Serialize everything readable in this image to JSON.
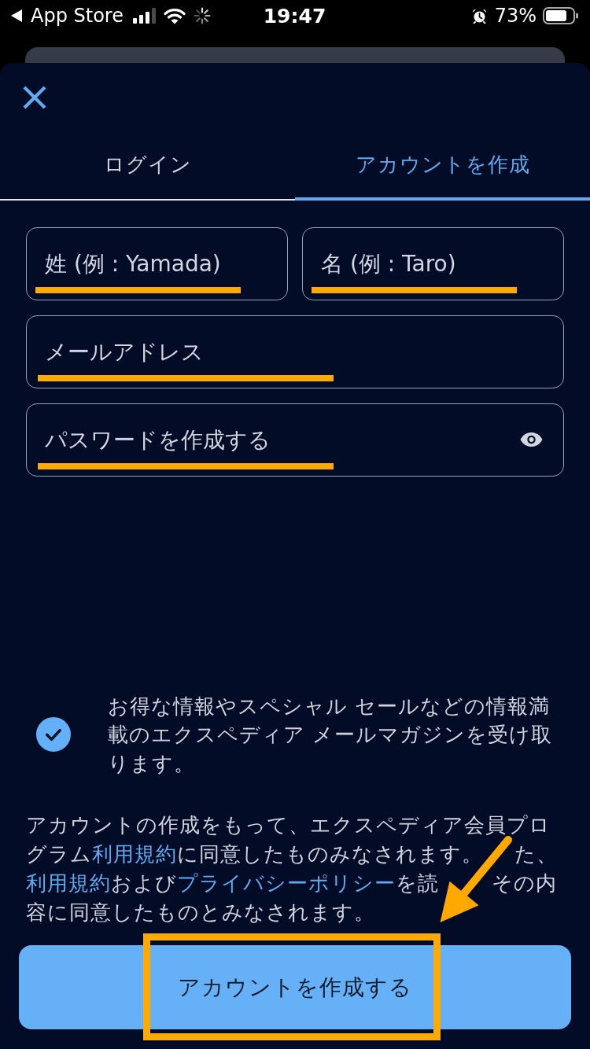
{
  "status_bar": {
    "back_label": "App Store",
    "time": "19:47",
    "battery": "73%"
  },
  "tabs": [
    {
      "label": "ログイン",
      "selected": false
    },
    {
      "label": "アカウントを作成",
      "selected": true
    }
  ],
  "field_rows": [
    [
      {
        "kind": "text",
        "placeholder": "姓 (例 : Yamada)",
        "highlighted": true
      },
      {
        "kind": "text",
        "placeholder": "名 (例 : Taro)",
        "highlighted": true
      }
    ],
    [
      {
        "kind": "email",
        "placeholder": "メールアドレス",
        "highlighted": true
      }
    ],
    [
      {
        "kind": "password",
        "placeholder": "パスワードを作成する",
        "highlighted": true
      }
    ]
  ],
  "newsletter": {
    "checked": true,
    "text": "お得な情報やスペシャル セールなどの情報満載のエクスペディア メールマガジンを受け取ります。"
  },
  "legal_text": [
    {
      "kind": "text",
      "text": "アカウントの作成をもって、エクスペディア会員プログラム"
    },
    {
      "kind": "link",
      "text": "利用規約"
    },
    {
      "kind": "text",
      "text": "に同意したものみなされます。"
    },
    {
      "kind": "covered"
    },
    {
      "kind": "text",
      "text": "た、"
    },
    {
      "kind": "link",
      "text": "利用規約"
    },
    {
      "kind": "text",
      "text": "および"
    },
    {
      "kind": "link",
      "text": "プライバシーポリシー"
    },
    {
      "kind": "text",
      "text": "を読"
    },
    {
      "kind": "covered"
    },
    {
      "kind": "text",
      "text": "その内容に同意したものとみなされます。"
    }
  ],
  "submit_button": {
    "label": "アカウントを作成する",
    "highlighted": true
  }
}
